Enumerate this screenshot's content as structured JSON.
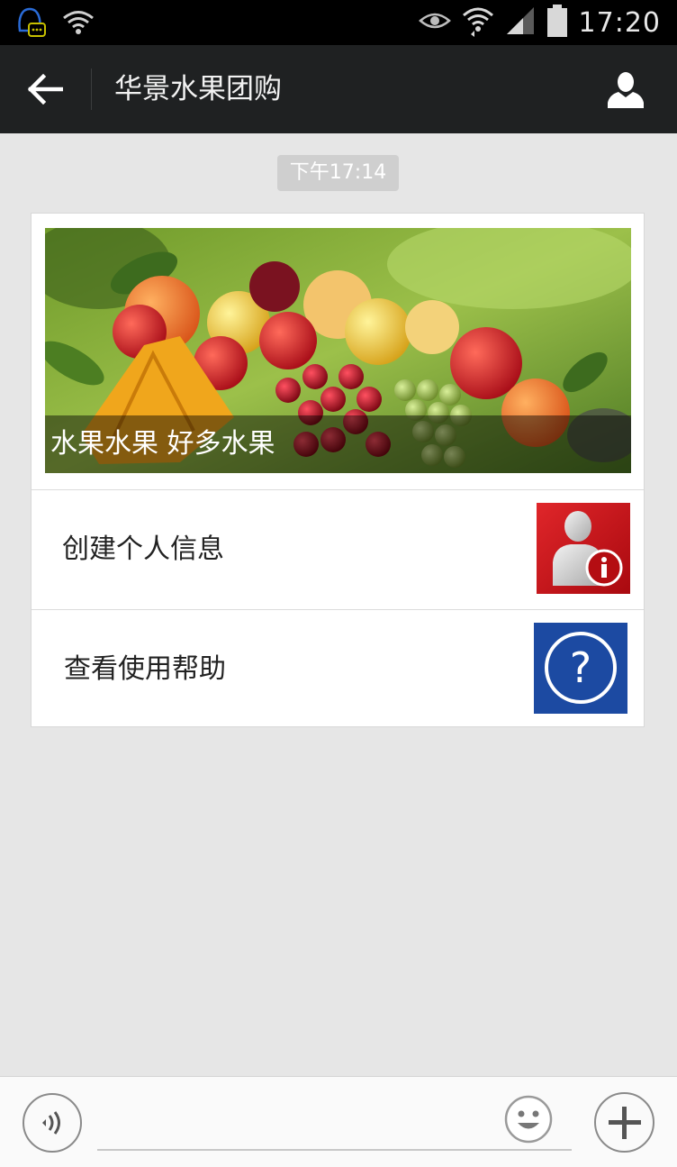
{
  "status_bar": {
    "time": "17:20",
    "icons": [
      "qq-notification-icon",
      "wifi-signal-icon",
      "eye-icon",
      "wifi-icon",
      "cellular-signal-icon",
      "battery-icon"
    ]
  },
  "header": {
    "title": "华景水果团购",
    "back_icon": "back-arrow-icon",
    "profile_icon": "person-icon"
  },
  "chat": {
    "timestamp": "下午17:14",
    "card": {
      "banner_caption": "水果水果 好多水果",
      "items": [
        {
          "label": "创建个人信息",
          "icon": "user-info-icon",
          "color": "#d01f1f"
        },
        {
          "label": "查看使用帮助",
          "icon": "help-question-icon",
          "color": "#1c4aa2"
        }
      ]
    }
  },
  "input_bar": {
    "voice_icon": "voice-icon",
    "text_value": "",
    "emoji_icon": "emoji-icon",
    "plus_icon": "plus-icon"
  }
}
